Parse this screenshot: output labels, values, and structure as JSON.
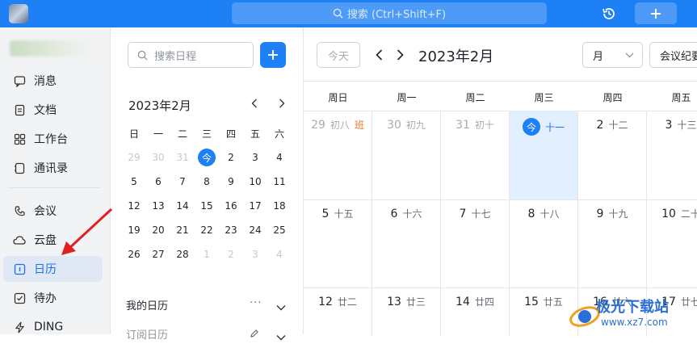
{
  "topbar": {
    "search_placeholder": "搜索 (Ctrl+Shift+F)",
    "accent": "#1d80f5"
  },
  "sidebar": {
    "items": [
      {
        "label": "消息",
        "icon": "message-icon"
      },
      {
        "label": "文档",
        "icon": "document-icon"
      },
      {
        "label": "工作台",
        "icon": "workbench-icon"
      },
      {
        "label": "通讯录",
        "icon": "contacts-icon"
      },
      {
        "label": "会议",
        "icon": "meeting-icon"
      },
      {
        "label": "云盘",
        "icon": "cloud-drive-icon"
      },
      {
        "label": "日历",
        "icon": "calendar-icon",
        "active": true
      },
      {
        "label": "待办",
        "icon": "todo-icon"
      },
      {
        "label": "DING",
        "icon": "ding-icon"
      }
    ]
  },
  "mini_calendar": {
    "search_placeholder": "搜索日程",
    "title": "2023年2月",
    "weekdays": [
      "日",
      "一",
      "二",
      "三",
      "四",
      "五",
      "六"
    ],
    "days": [
      {
        "t": "29",
        "dim": true
      },
      {
        "t": "30",
        "dim": true
      },
      {
        "t": "31",
        "dim": true
      },
      {
        "t": "今",
        "today": true
      },
      {
        "t": "2"
      },
      {
        "t": "3"
      },
      {
        "t": "4"
      },
      {
        "t": "5"
      },
      {
        "t": "6"
      },
      {
        "t": "7"
      },
      {
        "t": "8"
      },
      {
        "t": "9"
      },
      {
        "t": "10"
      },
      {
        "t": "11"
      },
      {
        "t": "12"
      },
      {
        "t": "13"
      },
      {
        "t": "14"
      },
      {
        "t": "15"
      },
      {
        "t": "16"
      },
      {
        "t": "17"
      },
      {
        "t": "18"
      },
      {
        "t": "19"
      },
      {
        "t": "20"
      },
      {
        "t": "21"
      },
      {
        "t": "22"
      },
      {
        "t": "23"
      },
      {
        "t": "24"
      },
      {
        "t": "25"
      },
      {
        "t": "26"
      },
      {
        "t": "27"
      },
      {
        "t": "28"
      },
      {
        "t": "1",
        "dim": true
      },
      {
        "t": "2",
        "dim": true
      },
      {
        "t": "3",
        "dim": true
      },
      {
        "t": "4",
        "dim": true
      }
    ],
    "my_calendars_label": "我的日历",
    "more_label": "···",
    "subscribed_label": "订阅日历"
  },
  "main": {
    "today_label": "今天",
    "month_title": "2023年2月",
    "view_value": "月",
    "meeting_label": "会议纪要",
    "weekdays": [
      "周日",
      "周一",
      "周二",
      "周三",
      "周四",
      "周五"
    ],
    "weeks": [
      [
        {
          "n": "29",
          "lunar": "初八",
          "tag": "班",
          "dim": true
        },
        {
          "n": "30",
          "lunar": "初九",
          "dim": true
        },
        {
          "n": "31",
          "lunar": "初十",
          "dim": true
        },
        {
          "n": "今",
          "lunar": "十一",
          "today": true
        },
        {
          "n": "2",
          "lunar": "十二"
        },
        {
          "n": "3",
          "lunar": "十三"
        }
      ],
      [
        {
          "n": "5",
          "lunar": "十五"
        },
        {
          "n": "6",
          "lunar": "十六"
        },
        {
          "n": "7",
          "lunar": "十七"
        },
        {
          "n": "8",
          "lunar": "十八"
        },
        {
          "n": "9",
          "lunar": "十九"
        },
        {
          "n": "10",
          "lunar": "二十"
        }
      ],
      [
        {
          "n": "12",
          "lunar": "廿二"
        },
        {
          "n": "13",
          "lunar": "廿三"
        },
        {
          "n": "14",
          "lunar": "廿四"
        },
        {
          "n": "15",
          "lunar": "廿五"
        },
        {
          "n": "16",
          "lunar": "廿六"
        },
        {
          "n": "17",
          "lunar": "廿七"
        }
      ]
    ]
  },
  "watermark": {
    "text": "极光下载站",
    "url": "www.xz7.com"
  }
}
